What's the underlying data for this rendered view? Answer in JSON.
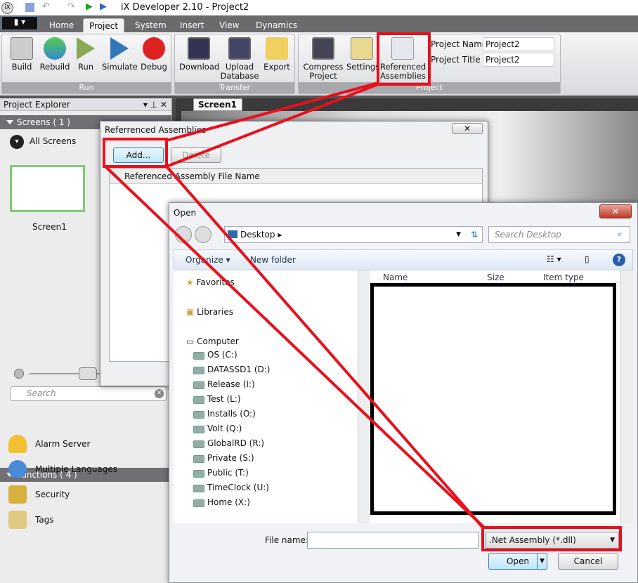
{
  "app": {
    "title": "iX Developer 2.10 - Project2"
  },
  "tabs": [
    "Home",
    "Project",
    "System",
    "Insert",
    "View",
    "Dynamics"
  ],
  "ribbon": {
    "run": {
      "label": "Run",
      "buttons": [
        "Build",
        "Rebuild",
        "Run",
        "Simulate",
        "Debug"
      ]
    },
    "transfer": {
      "label": "Transfer",
      "buttons": [
        "Download",
        "Upload Database",
        "Export"
      ]
    },
    "project": {
      "label": "Project",
      "buttons": [
        "Compress Project",
        "Settings",
        "Referenced Assemblies"
      ],
      "name_label": "Project Name",
      "name_value": "Project2",
      "title_label": "Project Title",
      "title_value": "Project2"
    }
  },
  "explorer": {
    "title": "Project Explorer",
    "screens_header": "Screens ( 1 )",
    "all_screens": "All Screens",
    "screen_name": "Screen1",
    "search_placeholder": "Search",
    "functions_header": "Functions ( 4 )",
    "functions": [
      "Alarm Server",
      "Multiple Languages",
      "Security",
      "Tags"
    ]
  },
  "doc_tab": "Screen1",
  "ref_dialog": {
    "title": "Referrenced Assemblies",
    "add": "Add...",
    "delete": "Delete",
    "column": "Referenced Assembly File Name"
  },
  "open_dialog": {
    "title": "Open",
    "location": "Desktop",
    "search_placeholder": "Search Desktop",
    "organize": "Organize",
    "new_folder": "New folder",
    "columns": [
      "Name",
      "Size",
      "Item type"
    ],
    "nav": {
      "favorites": "Favorites",
      "libraries": "Libraries",
      "computer": "Computer",
      "drives": [
        "OS (C:)",
        "DATASSD1 (D:)",
        "Release (I:)",
        "Test (L:)",
        "Installs (O:)",
        "Volt (Q:)",
        "GlobalRD (R:)",
        "Private (S:)",
        "Public (T:)",
        "TimeClock (U:)",
        "Home (X:)"
      ]
    },
    "file_name_label": "File name:",
    "file_name_value": "",
    "file_type": ".Net Assembly (*.dll)",
    "open": "Open",
    "cancel": "Cancel"
  },
  "colors": {
    "annotation": "#e8101c",
    "ribbon_dark": "#6b6b6d"
  }
}
